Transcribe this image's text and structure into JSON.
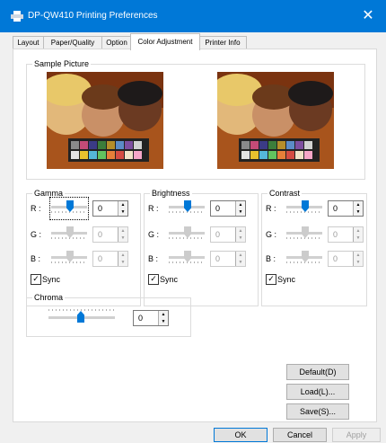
{
  "window": {
    "title": "DP-QW410 Printing Preferences",
    "close_glyph": "✕"
  },
  "tabs": [
    {
      "label": "Layout",
      "active": false
    },
    {
      "label": "Paper/Quality",
      "active": false
    },
    {
      "label": "Option",
      "active": false
    },
    {
      "label": "Color Adjustment",
      "active": true
    },
    {
      "label": "Printer Info",
      "active": false
    }
  ],
  "sample": {
    "label": "Sample Picture"
  },
  "gamma": {
    "label": "Gamma",
    "r_label": "R :",
    "g_label": "G :",
    "b_label": "B :",
    "r_value": "0",
    "g_value": "0",
    "b_value": "0",
    "sync_label": "Sync",
    "sync_checked": "☑"
  },
  "brightness": {
    "label": "Brightness",
    "r_label": "R :",
    "g_label": "G :",
    "b_label": "B :",
    "r_value": "0",
    "g_value": "0",
    "b_value": "0",
    "sync_label": "Sync"
  },
  "contrast": {
    "label": "Contrast",
    "r_label": "R :",
    "g_label": "G :",
    "b_label": "B :",
    "r_value": "0",
    "g_value": "0",
    "b_value": "0",
    "sync_label": "Sync"
  },
  "chroma": {
    "label": "Chroma",
    "value": "0"
  },
  "buttons": {
    "default": "Default(D)",
    "load": "Load(L)...",
    "save": "Save(S)...",
    "ok": "OK",
    "cancel": "Cancel",
    "apply": "Apply"
  },
  "colors": {
    "accent": "#0078d7",
    "titlebar": "#0078d7"
  },
  "icons": {
    "printer": "printer-icon",
    "close": "close-icon",
    "check": "✓",
    "spin_up": "▲",
    "spin_down": "▼"
  }
}
